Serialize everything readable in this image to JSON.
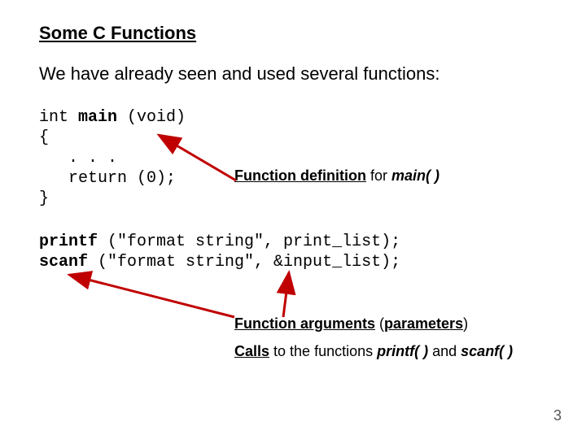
{
  "title": "Some C Functions",
  "intro": "We have already seen and used several functions:",
  "code_block1": {
    "l1a": "int ",
    "l1b": "main",
    "l1c": " (void)",
    "l2": "{",
    "l3": "   . . .",
    "l4": "   return (0);",
    "l5": "}"
  },
  "ann1": {
    "p1": "Function definition",
    "p2": " for ",
    "p3": "main( )"
  },
  "code_block2": {
    "l1a": "printf",
    "l1b": " (\"format string\", print_list);",
    "l2a": "scanf",
    "l2b": " (\"format string\", &input_list);"
  },
  "ann2": {
    "p1": "Function arguments",
    "p2": " (",
    "p3": "parameters",
    "p4": ")"
  },
  "ann3": {
    "p1": "Calls",
    "p2": " to the functions ",
    "p3": "printf( )",
    "p4": " and ",
    "p5": "scanf( )"
  },
  "pageno": "3"
}
